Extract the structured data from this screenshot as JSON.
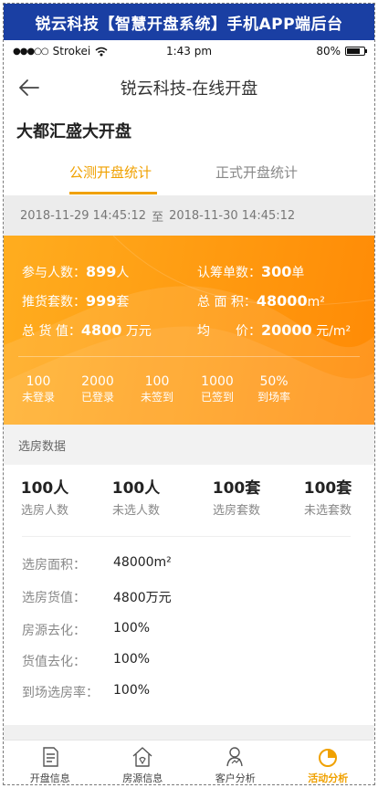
{
  "banner": {
    "title": "锐云科技【智慧开盘系统】手机APP端后台"
  },
  "statusbar": {
    "carrier": "Strokei",
    "time": "1:43 pm",
    "battery": "80%"
  },
  "navbar": {
    "title": "锐云科技-在线开盘"
  },
  "project": {
    "title": "大都汇盛大开盘"
  },
  "tabs": [
    {
      "label": "公测开盘统计",
      "active": true
    },
    {
      "label": "正式开盘统计",
      "active": false
    }
  ],
  "daterange": {
    "start": "2018-11-29  14:45:12",
    "sep": "至",
    "end": "2018-11-30  14:45:12"
  },
  "summary": {
    "participants": {
      "label": "参与人数：",
      "value": "899",
      "unit": "人"
    },
    "subscriptions": {
      "label": "认筹单数：",
      "value": "300",
      "unit": "单"
    },
    "units": {
      "label": "推货套数：",
      "value": "999",
      "unit": "套"
    },
    "area": {
      "label": "总 面 积：",
      "value": "48000",
      "unit": "m²"
    },
    "totalvalue": {
      "label": "总 货 值：",
      "value": "4800",
      "unit": " 万元"
    },
    "price": {
      "label": "均　　价：",
      "value": "20000",
      "unit": " 元/m²"
    },
    "minis": [
      {
        "num": "100",
        "label": "未登录"
      },
      {
        "num": "2000",
        "label": "已登录"
      },
      {
        "num": "100",
        "label": "未签到"
      },
      {
        "num": "1000",
        "label": "已签到"
      },
      {
        "num": "50%",
        "label": "到场率"
      }
    ]
  },
  "section": {
    "title": "选房数据"
  },
  "counts": [
    {
      "value": "100人",
      "label": "选房人数"
    },
    {
      "value": "100人",
      "label": "未选人数"
    },
    {
      "value": "100套",
      "label": "选房套数"
    },
    {
      "value": "100套",
      "label": "未选套数"
    }
  ],
  "details": [
    {
      "key": "选房面积：",
      "value": "48000m²"
    },
    {
      "key": "选房货值：",
      "value": "4800万元"
    },
    {
      "key": "房源去化：",
      "value": "100%"
    },
    {
      "key": "货值去化：",
      "value": "100%"
    },
    {
      "key": "到场选房率：",
      "value": "100%"
    }
  ],
  "tabbar": [
    {
      "label": "开盘信息",
      "icon": "document-icon",
      "active": false
    },
    {
      "label": "房源信息",
      "icon": "house-icon",
      "active": false
    },
    {
      "label": "客户分析",
      "icon": "person-chart-icon",
      "active": false
    },
    {
      "label": "活动分析",
      "icon": "pie-chart-icon",
      "active": true
    }
  ],
  "colors": {
    "banner": "#1a3fa3",
    "accent": "#f0a100",
    "orange": "#ff9a10"
  }
}
